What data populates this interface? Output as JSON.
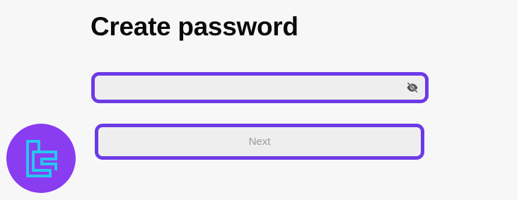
{
  "page": {
    "title": "Create password"
  },
  "password": {
    "value": "",
    "placeholder": "",
    "toggle_icon": "eye-off-icon"
  },
  "actions": {
    "next_label": "Next"
  },
  "brand": {
    "logo_icon": "brand-logo",
    "logo_color": "#8a3cf0",
    "logo_mark_color": "#27c6f0"
  },
  "colors": {
    "accent": "#6c3ae6",
    "field_background": "#efeeee",
    "page_background": "#f7f7f7"
  }
}
